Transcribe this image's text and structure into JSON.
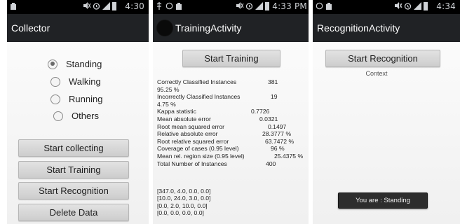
{
  "collector": {
    "status_time": "4:30",
    "title": "Collector",
    "radios": [
      {
        "label": "Standing",
        "checked": true
      },
      {
        "label": "Walking",
        "checked": false
      },
      {
        "label": "Running",
        "checked": false
      },
      {
        "label": "Others",
        "checked": false
      }
    ],
    "buttons": [
      "Start collecting",
      "Start Training",
      "Start Recognition",
      "Delete Data"
    ]
  },
  "training": {
    "status_time": "4:33 PM",
    "title": "TrainingActivity",
    "start_button": "Start Training",
    "stats": [
      {
        "label": "Correctly Classified Instances",
        "value": "381"
      },
      {
        "label": "95.25   %",
        "value": ""
      },
      {
        "label": "Incorrectly Classified Instances",
        "value": "19"
      },
      {
        "label": "4.75   %",
        "value": ""
      },
      {
        "label": "Kappa statistic",
        "value": "0.7726"
      },
      {
        "label": "Mean absolute error",
        "value": "0.0321"
      },
      {
        "label": "Root mean squared error",
        "value": "0.1497"
      },
      {
        "label": "Relative absolute error",
        "value": "28.3777 %"
      },
      {
        "label": "Root relative squared error",
        "value": "63.7472 %"
      },
      {
        "label": "Coverage of cases (0.95 level)",
        "value": "96     %"
      },
      {
        "label": "Mean rel. region size (0.95 level)",
        "value": "25.4375 %"
      },
      {
        "label": "Total Number of Instances",
        "value": "400"
      }
    ],
    "matrix": [
      "[347.0, 4.0, 0.0, 0.0]",
      "[10.0, 24.0, 3.0, 0.0]",
      "[0.0, 2.0, 10.0, 0.0]",
      "[0.0, 0.0, 0.0, 0.0]"
    ]
  },
  "recognition": {
    "status_time": "4:34",
    "title": "RecognitionActivity",
    "start_button": "Start Recognition",
    "context_label": "Context",
    "toast": "You are : Standing"
  },
  "icons": {
    "statusbar": [
      "usb-icon",
      "notification-icon",
      "mute-icon",
      "alarm-icon",
      "signal-icon",
      "battery-icon"
    ]
  },
  "colors": {
    "statusbar_bg": "#000000",
    "actionbar_bg": "#202225",
    "button_bg": "#d6d6d6",
    "toast_bg": "#2d2d2d"
  }
}
